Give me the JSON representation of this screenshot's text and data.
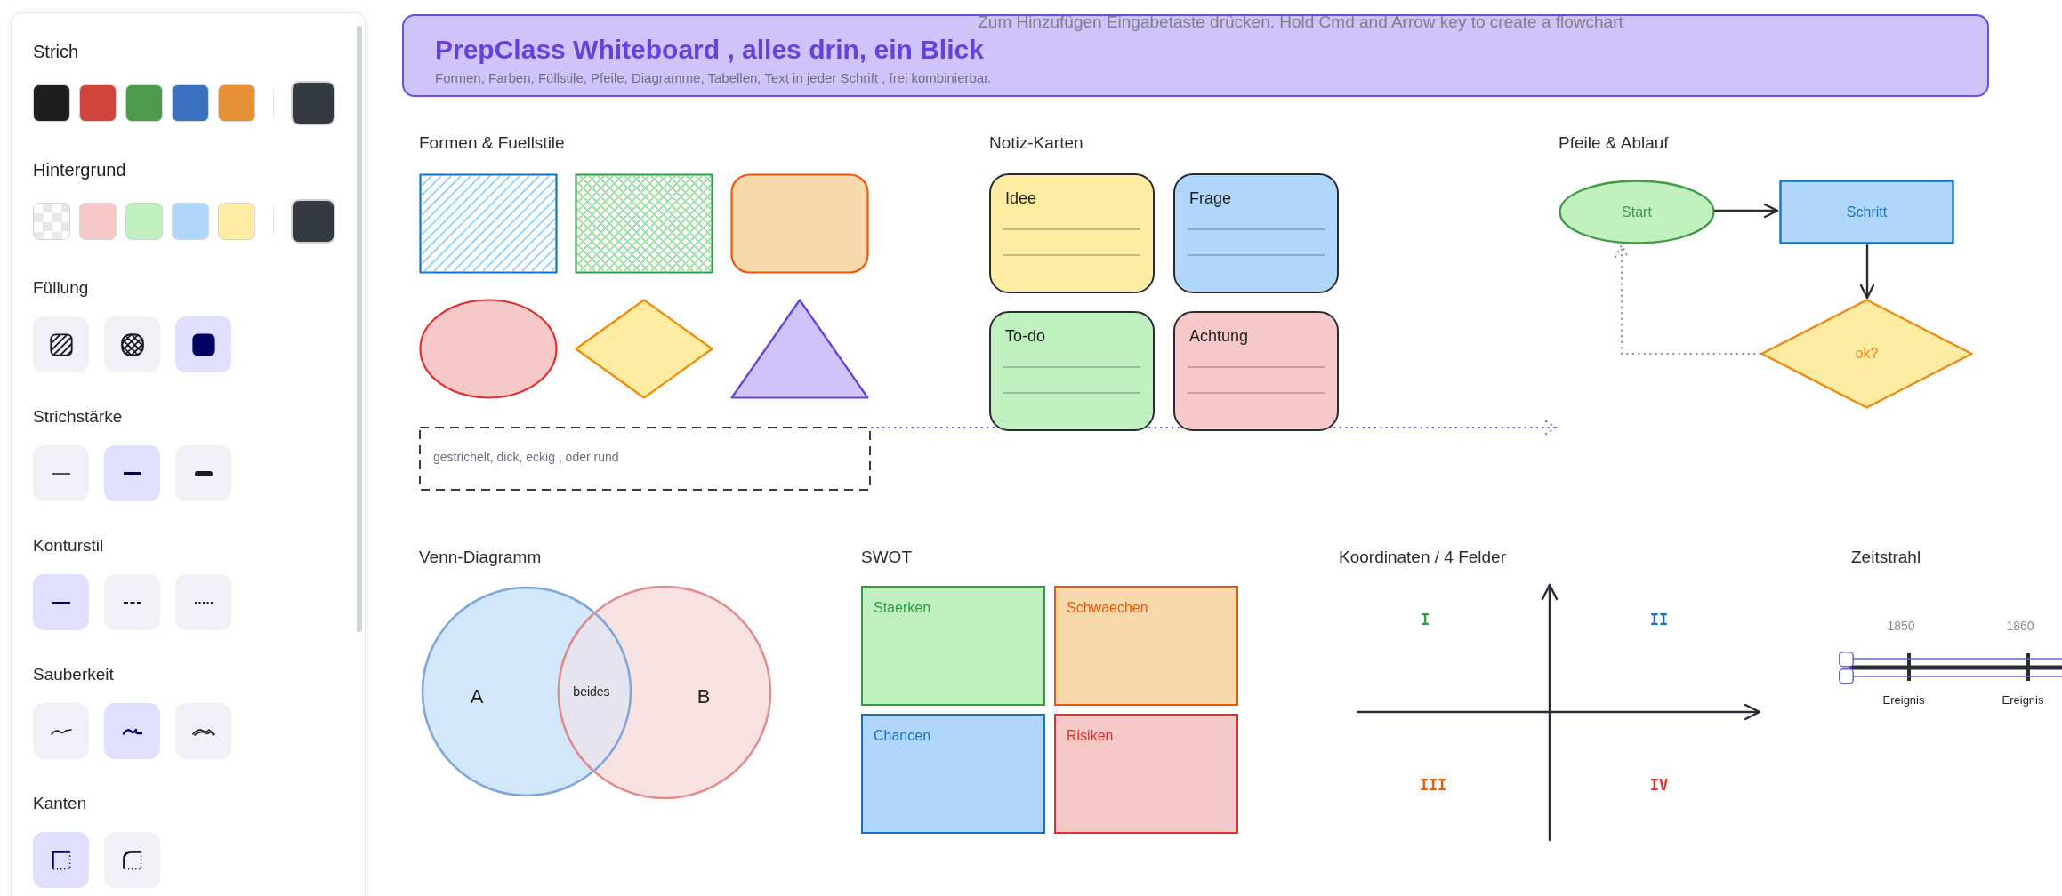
{
  "panel": {
    "sections": [
      {
        "kind": "colors",
        "label": "Strich",
        "swatches": [
          {
            "kind": "solid",
            "color": "#1e1e1e"
          },
          {
            "kind": "solid",
            "color": "#d1433b"
          },
          {
            "kind": "solid",
            "color": "#4e9a4c"
          },
          {
            "kind": "solid",
            "color": "#3a72c0"
          },
          {
            "kind": "solid",
            "color": "#e69035"
          }
        ],
        "current": {
          "color": "#343a40"
        }
      },
      {
        "kind": "colors",
        "label": "Hintergrund",
        "swatches": [
          {
            "kind": "transparent"
          },
          {
            "kind": "solid",
            "color": "#f6c8c8"
          },
          {
            "kind": "solid",
            "color": "#c0efc0"
          },
          {
            "kind": "solid",
            "color": "#b1d6fb"
          },
          {
            "kind": "solid",
            "color": "#fdeca2"
          }
        ],
        "current": {
          "color": "#343a40"
        }
      },
      {
        "kind": "options",
        "label": "Füllung",
        "options": [
          {
            "kind": "hachure",
            "selected": false
          },
          {
            "kind": "cross-hatch",
            "selected": false
          },
          {
            "kind": "solid-fill",
            "selected": true
          }
        ]
      },
      {
        "kind": "options",
        "label": "Strichstärke",
        "options": [
          {
            "kind": "thin",
            "selected": false
          },
          {
            "kind": "bold",
            "selected": true
          },
          {
            "kind": "extra-bold",
            "selected": false
          }
        ]
      },
      {
        "kind": "options",
        "label": "Konturstil",
        "options": [
          {
            "kind": "solid-line",
            "selected": true
          },
          {
            "kind": "dashed-line",
            "selected": false
          },
          {
            "kind": "dotted-line",
            "selected": false
          }
        ]
      },
      {
        "kind": "options",
        "label": "Sauberkeit",
        "options": [
          {
            "kind": "architect",
            "selected": false
          },
          {
            "kind": "artist",
            "selected": true
          },
          {
            "kind": "cartoonist",
            "selected": false
          }
        ]
      },
      {
        "kind": "options",
        "label": "Kanten",
        "options": [
          {
            "kind": "sharp",
            "selected": true
          },
          {
            "kind": "round",
            "selected": false
          }
        ]
      }
    ]
  },
  "canvas": {
    "hint": "Zum Hinzufügen Eingabetaste drücken. Hold Cmd and Arrow key to create a flowchart",
    "banner": {
      "title": "PrepClass Whiteboard , alles drin, ein Blick",
      "subtitle": "Formen, Farben, Füllstile, Pfeile, Diagramme, Tabellen, Text in jeder Schrift , frei kombinierbar."
    },
    "shapes": {
      "title": "Formen & Fuellstile",
      "items": [
        {
          "kind": "rectangle",
          "color": "#1971c2",
          "fill": {
            "kind": "hachure",
            "color": "#a5d8ff"
          }
        },
        {
          "kind": "rectangle",
          "color": "#2f9e44",
          "fill": {
            "kind": "cross-hatch",
            "color": "#9fe6aa"
          }
        },
        {
          "kind": "rounded-rectangle",
          "color": "#e8590c",
          "fill": {
            "kind": "solid",
            "color": "#f8d9ab"
          }
        },
        {
          "kind": "ellipse",
          "color": "#e03131",
          "fill": {
            "kind": "solid",
            "color": "#f6c8c8"
          }
        },
        {
          "kind": "diamond",
          "color": "#f08c00",
          "fill": {
            "kind": "solid",
            "color": "#fdeca2"
          }
        },
        {
          "kind": "triangle",
          "color": "#6741d9",
          "fill": {
            "kind": "solid",
            "color": "#cfc3fb"
          }
        }
      ],
      "dashed_box": {
        "text": "gestrichelt, dick, eckig , oder rund"
      }
    },
    "notes": {
      "title": "Notiz-Karten",
      "cards": [
        {
          "label": "Idee",
          "color": "#fdeca2"
        },
        {
          "label": "Frage",
          "color": "#b1d6fb"
        },
        {
          "label": "To-do",
          "color": "#c0efc0"
        },
        {
          "label": "Achtung",
          "color": "#f6c8c8"
        }
      ]
    },
    "flow": {
      "title": "Pfeile & Ablauf",
      "nodes": [
        {
          "kind": "ellipse",
          "label": "Start",
          "color": "#409a46",
          "fill": {
            "color": "#c0efc0"
          }
        },
        {
          "kind": "rectangle",
          "label": "Schritt",
          "color": "#1971c2",
          "fill": {
            "color": "#b1d6fb"
          }
        },
        {
          "kind": "diamond",
          "label": "ok?",
          "color": "#ec8a14",
          "fill": {
            "color": "#fdeca2"
          }
        }
      ]
    },
    "venn": {
      "title": "Venn-Diagramm",
      "sets": [
        {
          "label": "A",
          "color": "#7ca6dc",
          "fill": {
            "color": "#d3e7fb"
          }
        },
        {
          "label": "B",
          "color": "#e08c8c",
          "fill": {
            "color": "#f8e1e1"
          }
        }
      ],
      "overlap": "beides"
    },
    "swot": {
      "title": "SWOT",
      "cells": [
        {
          "label": "Staerken",
          "color": "#2f9e44",
          "fill": {
            "color": "#c0efc0"
          }
        },
        {
          "label": "Schwaechen",
          "color": "#e8590c",
          "fill": {
            "color": "#f8d9ab"
          }
        },
        {
          "label": "Chancen",
          "color": "#1971c2",
          "fill": {
            "color": "#b1d6fb"
          }
        },
        {
          "label": "Risiken",
          "color": "#e03131",
          "fill": {
            "color": "#f6c8c8"
          }
        }
      ]
    },
    "quadrants": {
      "title": "Koordinaten / 4 Felder",
      "labels": [
        {
          "text": "I",
          "color": "#2f9e44"
        },
        {
          "text": "II",
          "color": "#1971c2"
        },
        {
          "text": "III",
          "color": "#e8590c"
        },
        {
          "text": "IV",
          "color": "#e03131"
        }
      ]
    },
    "timeline": {
      "title": "Zeitstrahl",
      "selected": true,
      "events": [
        {
          "year": "1850",
          "label": "Ereignis"
        },
        {
          "year": "1860",
          "label": "Ereignis"
        }
      ]
    }
  }
}
